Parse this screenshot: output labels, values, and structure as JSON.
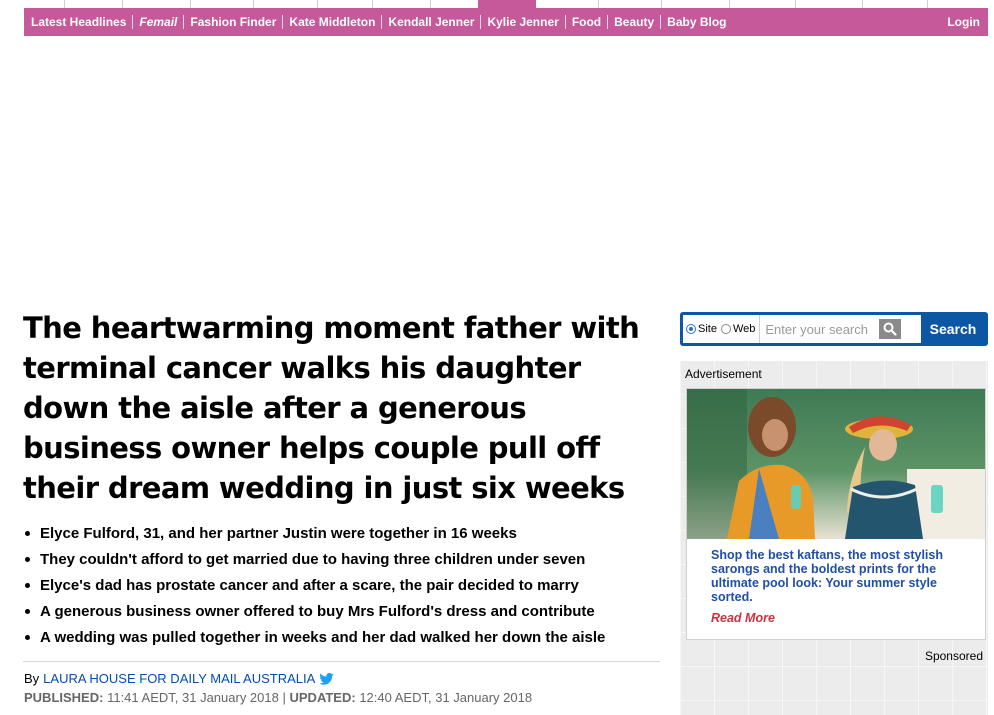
{
  "nav": {
    "items": [
      "Latest Headlines",
      "Femail",
      "Fashion Finder",
      "Kate Middleton",
      "Kendall Jenner",
      "Kylie Jenner",
      "Food",
      "Beauty",
      "Baby Blog"
    ],
    "login": "Login",
    "color": "#c6599a"
  },
  "article": {
    "headline": "The heartwarming moment father with terminal cancer walks his daughter down the aisle after a generous business owner helps couple pull off their dream wedding in just six weeks",
    "bullets": [
      "Elyce Fulford, 31, and her partner Justin were together in 16 weeks",
      "They couldn't afford to get married due to having three children under seven",
      "Elyce's dad has prostate cancer and after a scare, the pair decided to marry",
      "A generous business owner offered to buy Mrs Fulford's dress and contribute",
      "A wedding was pulled together in weeks and her dad walked her down the aisle"
    ],
    "byline_prefix": "By",
    "author": "LAURA HOUSE FOR DAILY MAIL AUSTRALIA",
    "published_label": "PUBLISHED:",
    "published_value": "11:41 AEDT, 31 January 2018",
    "separator": "|",
    "updated_label": "UPDATED:",
    "updated_value": "12:40 AEDT, 31 January 2018"
  },
  "search": {
    "options": [
      "Site",
      "Web"
    ],
    "selected": "Site",
    "placeholder": "Enter your search",
    "button_label": "Search",
    "color": "#0b57a4"
  },
  "ad": {
    "label": "Advertisement",
    "text": "Shop the best kaftans, the most stylish sarongs and the boldest prints for the ultimate pool look: Your summer style sorted.",
    "read_more": "Read More",
    "sponsored": "Sponsored",
    "text_color": "#1f4fa8",
    "read_more_color": "#c8323c"
  }
}
